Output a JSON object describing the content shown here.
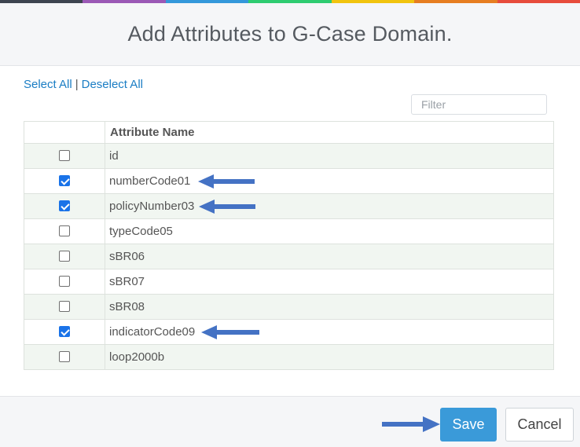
{
  "colors": {
    "top_bar": [
      "#3d4450",
      "#9b59b6",
      "#3498db",
      "#2ecc71",
      "#f1c40f",
      "#e67e22",
      "#e74c3c"
    ],
    "accent": "#1a7dc4",
    "save_button": "#3a9ad9",
    "annotation_arrow": "#4472c4"
  },
  "dialog": {
    "title": "Add Attributes to G-Case Domain."
  },
  "selection": {
    "select_all": "Select All",
    "separator": "|",
    "deselect_all": "Deselect All"
  },
  "filter": {
    "placeholder": "Filter",
    "value": ""
  },
  "table": {
    "header": "Attribute Name",
    "rows": [
      {
        "name": "id",
        "checked": false
      },
      {
        "name": "numberCode01",
        "checked": true
      },
      {
        "name": "policyNumber03",
        "checked": true
      },
      {
        "name": "typeCode05",
        "checked": false
      },
      {
        "name": "sBR06",
        "checked": false
      },
      {
        "name": "sBR07",
        "checked": false
      },
      {
        "name": "sBR08",
        "checked": false
      },
      {
        "name": "indicatorCode09",
        "checked": true
      },
      {
        "name": "loop2000b",
        "checked": false
      }
    ]
  },
  "footer": {
    "save_label": "Save",
    "cancel_label": "Cancel"
  }
}
